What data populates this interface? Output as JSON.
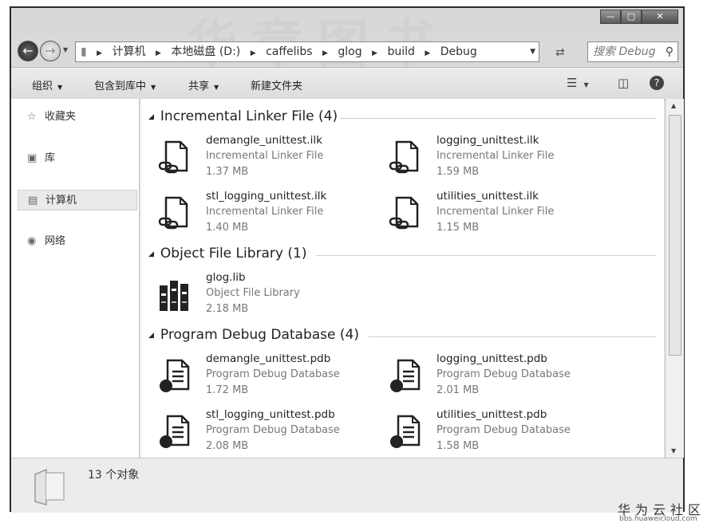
{
  "watermark": "华章图书",
  "window_controls": {
    "minimize": "—",
    "maximize": "▢",
    "close": "✕"
  },
  "nav": {
    "back_icon": "back-arrow-icon",
    "forward_icon": "forward-arrow-icon"
  },
  "address": {
    "crumbs": [
      "计算机",
      "本地磁盘 (D:)",
      "caffelibs",
      "glog",
      "build",
      "Debug"
    ]
  },
  "search": {
    "placeholder": "搜索 Debug"
  },
  "toolbar": {
    "organize": "组织",
    "include_in_library": "包含到库中",
    "share": "共享",
    "new_folder": "新建文件夹"
  },
  "navpane": {
    "items": [
      {
        "label": "收藏夹",
        "icon": "star-icon"
      },
      {
        "label": "库",
        "icon": "library-icon"
      },
      {
        "label": "计算机",
        "icon": "computer-icon"
      },
      {
        "label": "网络",
        "icon": "network-icon"
      }
    ]
  },
  "groups": [
    {
      "title": "Incremental Linker File (4)",
      "files": [
        {
          "name": "demangle_unittest.ilk",
          "type": "Incremental Linker File",
          "size": "1.37 MB",
          "icon": "linker-file-icon"
        },
        {
          "name": "logging_unittest.ilk",
          "type": "Incremental Linker File",
          "size": "1.59 MB",
          "icon": "linker-file-icon"
        },
        {
          "name": "stl_logging_unittest.ilk",
          "type": "Incremental Linker File",
          "size": "1.40 MB",
          "icon": "linker-file-icon"
        },
        {
          "name": "utilities_unittest.ilk",
          "type": "Incremental Linker File",
          "size": "1.15 MB",
          "icon": "linker-file-icon"
        }
      ]
    },
    {
      "title": "Object File Library (1)",
      "files": [
        {
          "name": "glog.lib",
          "type": "Object File Library",
          "size": "2.18 MB",
          "icon": "library-books-icon"
        }
      ]
    },
    {
      "title": "Program Debug Database (4)",
      "files": [
        {
          "name": "demangle_unittest.pdb",
          "type": "Program Debug Database",
          "size": "1.72 MB",
          "icon": "debug-db-icon"
        },
        {
          "name": "logging_unittest.pdb",
          "type": "Program Debug Database",
          "size": "2.01 MB",
          "icon": "debug-db-icon"
        },
        {
          "name": "stl_logging_unittest.pdb",
          "type": "Program Debug Database",
          "size": "2.08 MB",
          "icon": "debug-db-icon"
        },
        {
          "name": "utilities_unittest.pdb",
          "type": "Program Debug Database",
          "size": "1.58 MB",
          "icon": "debug-db-icon"
        }
      ]
    }
  ],
  "status": {
    "count": "13 个对象"
  },
  "branding": {
    "name": "华为云社区",
    "url": "bbs.huaweicloud.com"
  }
}
